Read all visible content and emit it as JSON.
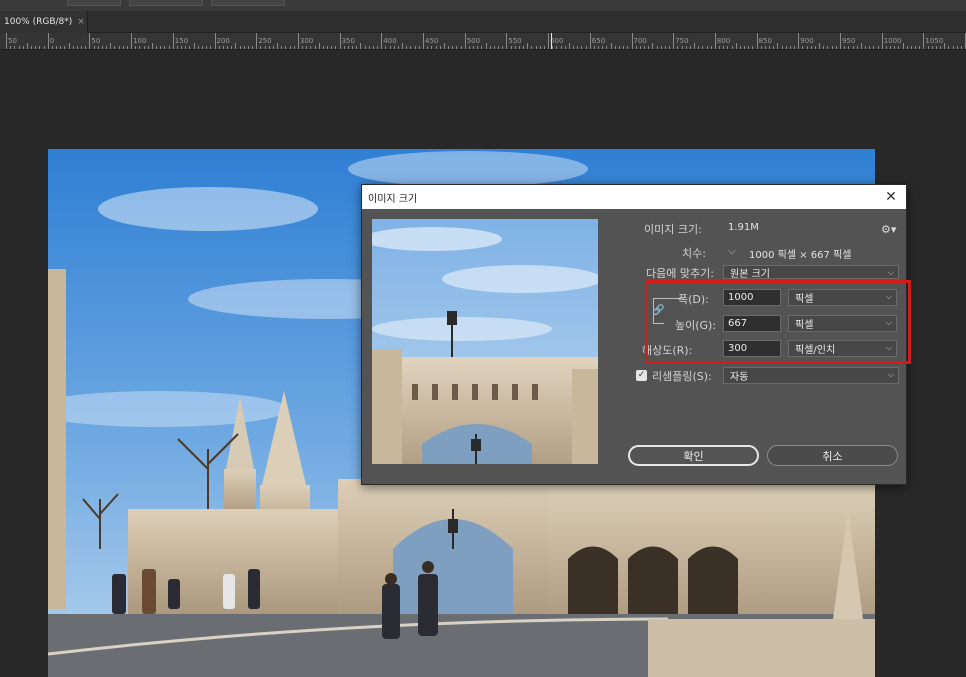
{
  "document_tab": {
    "title": "100% (RGB/8*)",
    "close_glyph": "×"
  },
  "ruler": {
    "labels": [
      "50",
      "0",
      "50",
      "100",
      "150",
      "200",
      "250",
      "300",
      "350",
      "400",
      "450",
      "500",
      "550",
      "600",
      "650",
      "700",
      "750",
      "800",
      "850",
      "900",
      "950",
      "1000",
      "1050",
      "11"
    ]
  },
  "dialog": {
    "title": "이미지 크기",
    "close_glyph": "✕",
    "image_size_label": "이미지 크기:",
    "image_size_value": "1.91M",
    "settings_icon": "gear-icon",
    "dimensions_label": "치수:",
    "dimensions_value": "1000 픽셀 × 667 픽셀",
    "fit_to_label": "다음에 맞추기:",
    "fit_to_value": "원본 크기",
    "width_label": "폭(D):",
    "width_value": "1000",
    "width_unit": "픽셀",
    "height_label": "높이(G):",
    "height_value": "667",
    "height_unit": "픽셀",
    "resolution_label": "해상도(R):",
    "resolution_value": "300",
    "resolution_unit": "픽셀/인치",
    "resample_label": "리샘플링(S):",
    "resample_checked": true,
    "resample_value": "자동",
    "ok_label": "확인",
    "cancel_label": "취소",
    "highlight_color": "#d51a1a"
  },
  "colors": {
    "canvas_bg": "#282828",
    "dialog_bg": "#535353",
    "sky": "#4a90d9"
  }
}
